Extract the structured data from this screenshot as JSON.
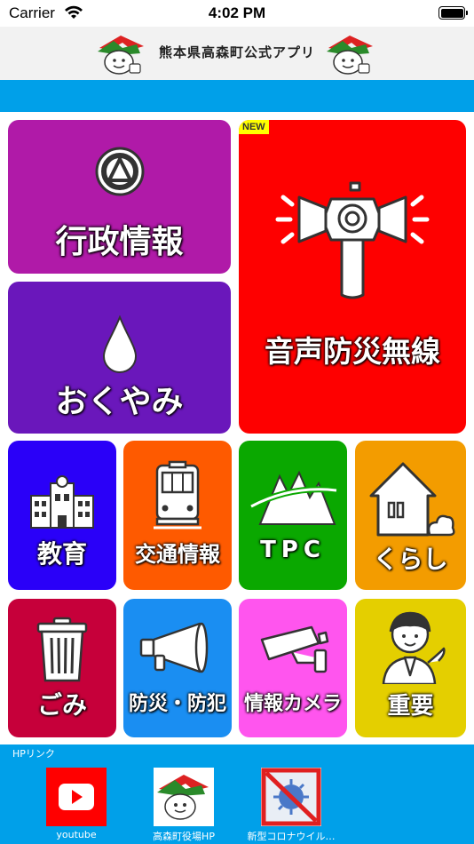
{
  "status": {
    "carrier": "Carrier",
    "time": "4:02 PM"
  },
  "header": {
    "title": "熊本県高森町公式アプリ"
  },
  "tiles": {
    "gyosei": {
      "label": "行政情報",
      "color": "#b01aa8"
    },
    "bosai_musen": {
      "label": "音声防災無線",
      "badge": "NEW",
      "color": "#fe0000"
    },
    "okuyami": {
      "label": "おくやみ",
      "color": "#6a17bb"
    },
    "kyoiku": {
      "label": "教育",
      "color": "#2a00f8"
    },
    "kotsu": {
      "label": "交通情報",
      "color": "#fe5a00"
    },
    "tpc": {
      "label": "TPC",
      "color": "#0aa800"
    },
    "kurashi": {
      "label": "くらし",
      "color": "#f39c00"
    },
    "gomi": {
      "label": "ごみ",
      "color": "#c6003a"
    },
    "bosai_bohan": {
      "label": "防災・防犯",
      "color": "#1a8ef2"
    },
    "camera": {
      "label": "情報カメラ",
      "color": "#ff55ee"
    },
    "juyo": {
      "label": "重要",
      "color": "#e4cf00"
    }
  },
  "footer": {
    "title": "HPリンク",
    "links": [
      {
        "caption": "youtube"
      },
      {
        "caption": "高森町役場HP"
      },
      {
        "caption": "新型コロナウイル…"
      }
    ]
  }
}
